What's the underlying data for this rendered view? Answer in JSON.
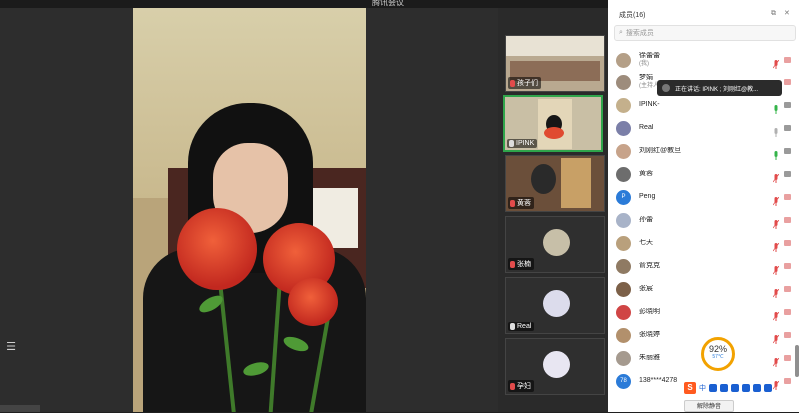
{
  "window": {
    "title": "腾讯会议"
  },
  "main_video": {
    "description_name": "speaker-video"
  },
  "thumbnails": [
    {
      "label": "孩子们",
      "muted": true
    },
    {
      "label": "IPINK",
      "muted": false
    },
    {
      "label": "黄蓉",
      "muted": true
    },
    {
      "label": "张楠",
      "muted": true
    },
    {
      "label": "Real",
      "muted": false
    },
    {
      "label": "孕妇",
      "muted": true
    }
  ],
  "panel": {
    "title": "成员(16)",
    "search_placeholder": "搜索成员",
    "controls": "⧉ ✕",
    "unmute_all": "解除静音"
  },
  "tooltip": {
    "text": "正在讲话: IPINK ; 刘刚红@教..."
  },
  "members": [
    {
      "name": "徐蕾蕾",
      "sub": "(我)",
      "mic": "muted",
      "cam": "off",
      "avatar_color": "#b49f87"
    },
    {
      "name": "梦娟",
      "sub": "(主持人)",
      "mic": "muted",
      "cam": "off",
      "avatar_color": "#9d8c7c"
    },
    {
      "name": "IPINK-",
      "sub": "",
      "mic": "on",
      "cam": "on",
      "avatar_color": "#c4b08c"
    },
    {
      "name": "Real",
      "sub": "",
      "mic": "idle",
      "cam": "on",
      "avatar_color": "#7b7fa8"
    },
    {
      "name": "刘刚红@教旦",
      "sub": "",
      "mic": "on",
      "cam": "on",
      "avatar_color": "#c7a38a"
    },
    {
      "name": "黄蓉",
      "sub": "",
      "mic": "muted",
      "cam": "on",
      "avatar_color": "#6d6d6d"
    },
    {
      "name": "Peng",
      "sub": "",
      "mic": "muted",
      "cam": "off",
      "avatar_color": "#2b7bd8",
      "avatar_text": "P"
    },
    {
      "name": "孙蕾",
      "sub": "",
      "mic": "muted",
      "cam": "off",
      "avatar_color": "#a8b3c8"
    },
    {
      "name": "七天",
      "sub": "",
      "mic": "muted",
      "cam": "off",
      "avatar_color": "#b9a07c"
    },
    {
      "name": "俞克克",
      "sub": "",
      "mic": "muted",
      "cam": "off",
      "avatar_color": "#8f7a63"
    },
    {
      "name": "张宸",
      "sub": "",
      "mic": "muted",
      "cam": "off",
      "avatar_color": "#7c6048"
    },
    {
      "name": "彭晓明",
      "sub": "",
      "mic": "muted",
      "cam": "off",
      "avatar_color": "#d04545"
    },
    {
      "name": "张晓婷",
      "sub": "",
      "mic": "muted",
      "cam": "off",
      "avatar_color": "#b2906c"
    },
    {
      "name": "朱丽雅",
      "sub": "",
      "mic": "muted",
      "cam": "off",
      "avatar_color": "#a59a8f"
    },
    {
      "name": "138****4278",
      "sub": "",
      "mic": "muted",
      "cam": "off",
      "avatar_color": "#2b7bd8",
      "avatar_text": "78"
    }
  ],
  "cpu_widget": {
    "percent": "92%",
    "temp": "57℃"
  },
  "ime": {
    "mode": "中"
  },
  "colors": {
    "green_active": "#2fa54b",
    "mic_muted": "#e24b4b",
    "mic_on": "#34b44a",
    "cpu_ring": "#f2a200"
  }
}
